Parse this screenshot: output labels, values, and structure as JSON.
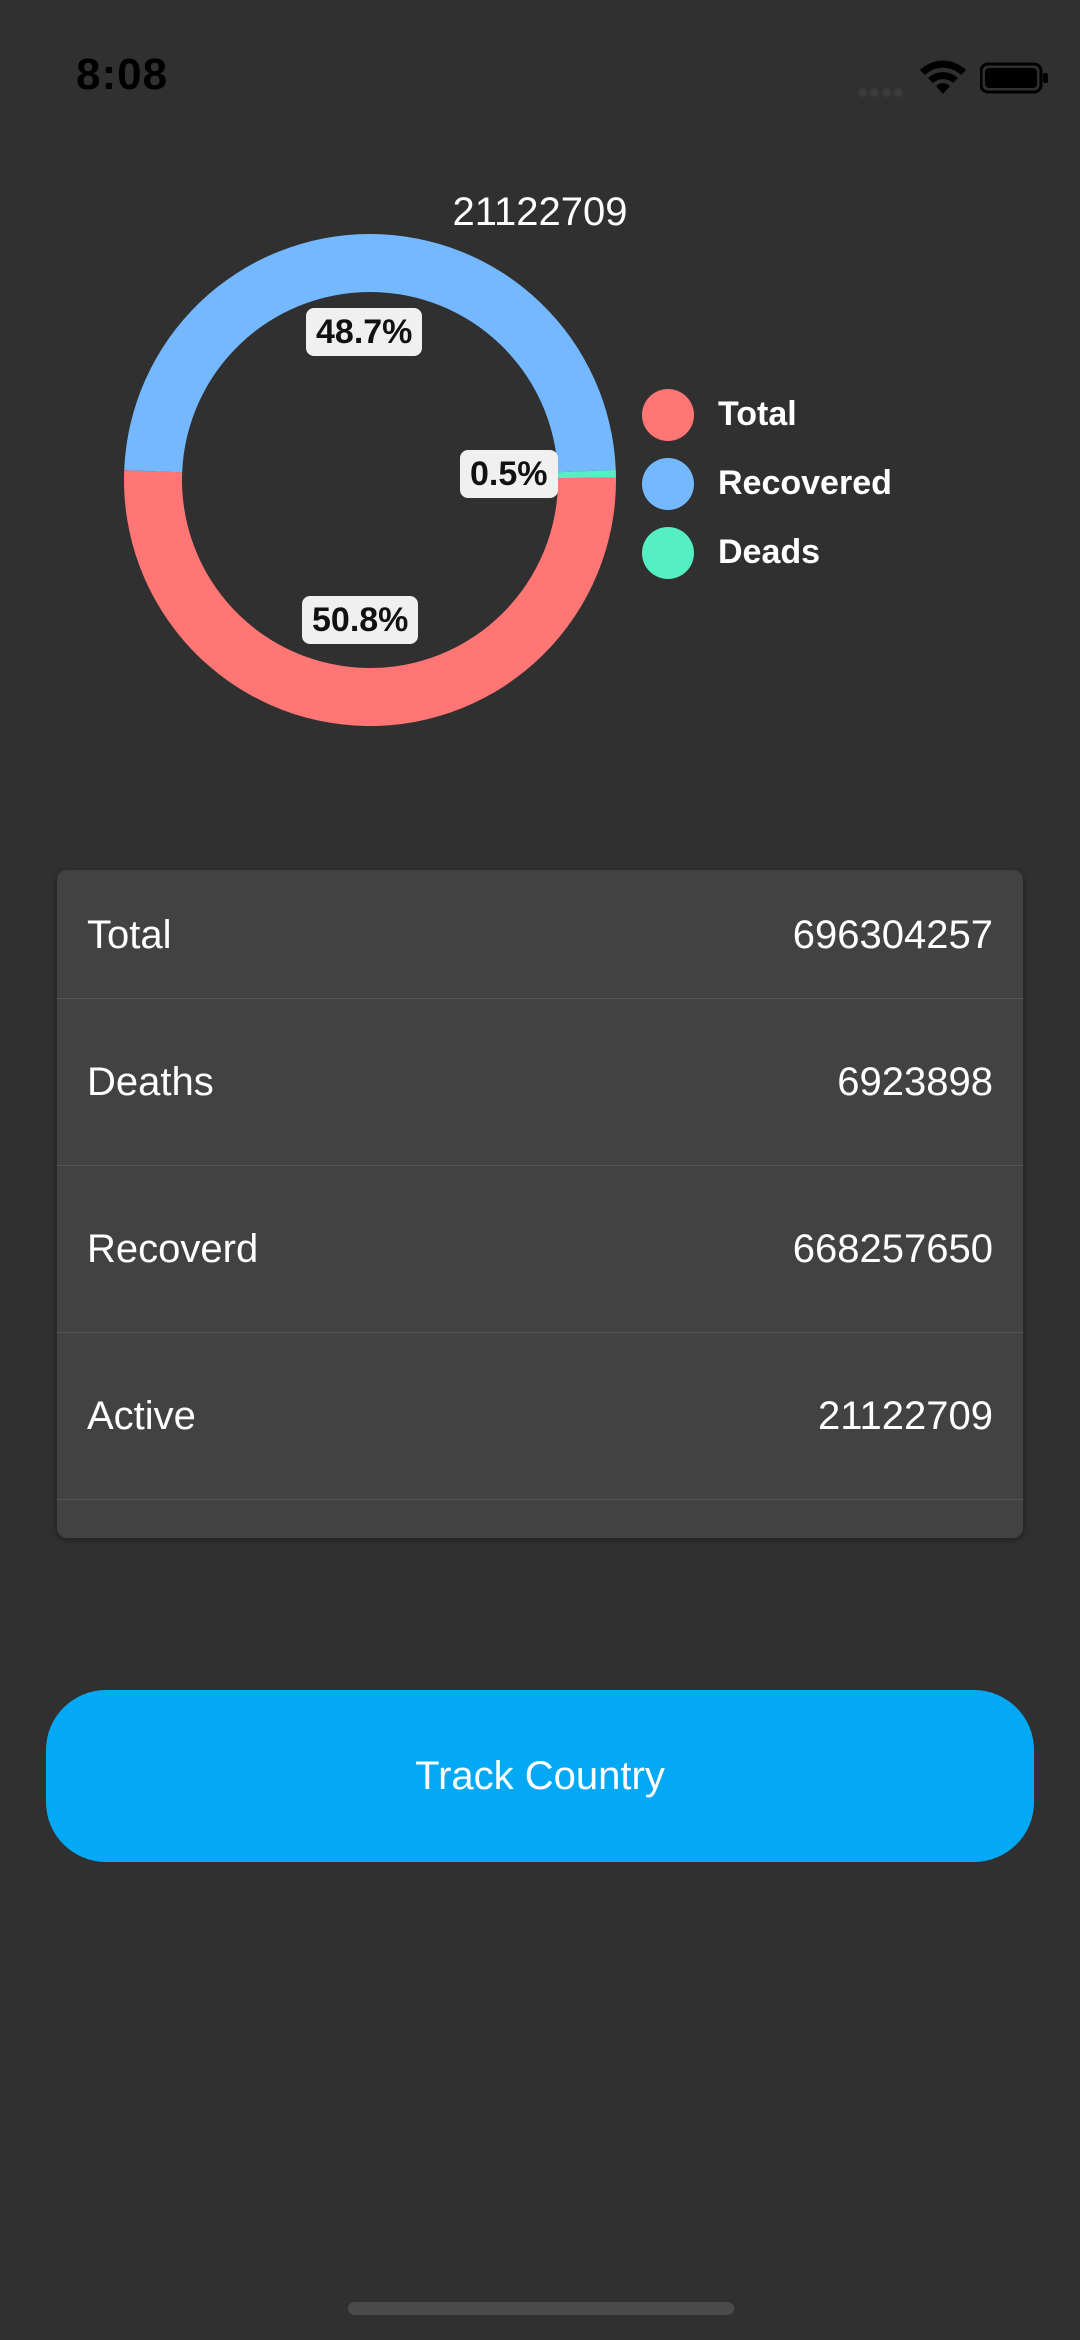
{
  "status_bar": {
    "time": "8:08"
  },
  "chart_data": {
    "type": "pie",
    "title": "21122709",
    "slices": [
      {
        "name": "Total",
        "value": 50.8,
        "label": "50.8%",
        "color": "#ff7675"
      },
      {
        "name": "Recovered",
        "value": 48.7,
        "label": "48.7%",
        "color": "#74b9ff"
      },
      {
        "name": "Deads",
        "value": 0.5,
        "label": "0.5%",
        "color": "#55efc4"
      }
    ],
    "legend_position": "right"
  },
  "stats": {
    "rows": [
      {
        "label": "Total",
        "value": "696304257"
      },
      {
        "label": "Deaths",
        "value": "6923898"
      },
      {
        "label": "Recoverd",
        "value": "668257650"
      },
      {
        "label": "Active",
        "value": "21122709"
      }
    ]
  },
  "actions": {
    "track_country_label": "Track Country"
  }
}
